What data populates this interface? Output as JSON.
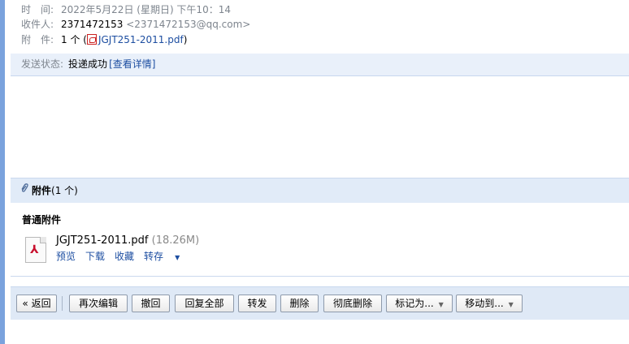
{
  "header": {
    "time_label": "时　间:",
    "time_value": "2022年5月22日 (星期日) 下午10：14",
    "to_label": "收件人:",
    "to_name": "2371472153",
    "to_email": "<2371472153@qq.com>",
    "att_label": "附　件:",
    "att_count": "1 个 (",
    "att_file": "JGJT251-2011.pdf",
    "att_close": ")"
  },
  "status": {
    "label": "发送状态:",
    "value": "投递成功",
    "detail_link": "[查看详情]"
  },
  "attachments": {
    "title": "附件",
    "count": "(1 个)",
    "subtitle": "普通附件",
    "file": {
      "name": "JGJT251-2011.pdf",
      "size": "(18.26M)",
      "actions": [
        "预览",
        "下载",
        "收藏",
        "转存"
      ]
    }
  },
  "toolbar": {
    "back": "« 返回",
    "reedit": "再次编辑",
    "recall": "撤回",
    "reply_all": "回复全部",
    "forward": "转发",
    "delete": "删除",
    "purge": "彻底删除",
    "mark_as": "标记为...",
    "move_to": "移动到..."
  },
  "icons": {
    "pdf": "pdf-icon",
    "paperclip": "paperclip-icon",
    "dropdown": "chevron-down-icon"
  },
  "colors": {
    "accent_strip": "#7aa2dd",
    "link": "#1d4ea1",
    "section_bg": "#e1ebf8"
  }
}
